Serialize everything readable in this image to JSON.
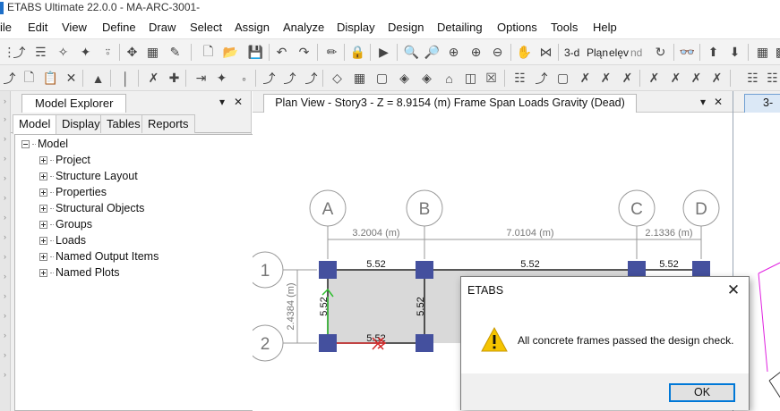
{
  "app": {
    "title": "ETABS Ultimate 22.0.0 - MA-ARC-3001-"
  },
  "menu": [
    "ile",
    "Edit",
    "View",
    "Define",
    "Draw",
    "Select",
    "Assign",
    "Analyze",
    "Display",
    "Design",
    "Detailing",
    "Options",
    "Tools",
    "Help"
  ],
  "toolbar": {
    "view_3d": "3-d",
    "view_plan": "Pląn",
    "view_elev": "elęv",
    "view_nd": "nd"
  },
  "model_explorer": {
    "title": "Model Explorer",
    "pin_icon": "▾",
    "close_icon": "✕",
    "tabs": [
      "Model",
      "Display",
      "Tables",
      "Reports"
    ],
    "active_tab": "Model",
    "root": "Model",
    "items": [
      "Project",
      "Structure Layout",
      "Properties",
      "Structural Objects",
      "Groups",
      "Loads",
      "Named Output Items",
      "Named Plots"
    ]
  },
  "plan_view": {
    "title": "Plan View - Story3 - Z = 8.9154 (m)  Frame Span Loads Gravity (Dead)",
    "pin_icon": "▾",
    "close_icon": "✕",
    "grid_x": [
      "A",
      "B",
      "C",
      "D"
    ],
    "grid_y": [
      "1",
      "2"
    ],
    "dim_ab": "3.2004 (m)",
    "dim_bc": "7.0104 (m)",
    "dim_cd": "2.1336 (m)",
    "dim_12": "2.4384 (m)",
    "load_labels": [
      "5.52",
      "5.52",
      "5.52",
      "5.52",
      "5.52",
      "5.52"
    ],
    "colors": {
      "joint": "#44509e",
      "beam": "#222222",
      "slab": "#d9d9d9",
      "local_x": "#d42a2a",
      "local_y": "#2fbf2f",
      "grid": "#9a9a9a",
      "section": "#e020e0"
    }
  },
  "right_window": {
    "tab_label": "3-"
  },
  "dialog": {
    "title": "ETABS",
    "close_icon": "✕",
    "message": "All concrete frames passed the design check.",
    "ok_label": "OK",
    "icon": "warning-icon"
  }
}
